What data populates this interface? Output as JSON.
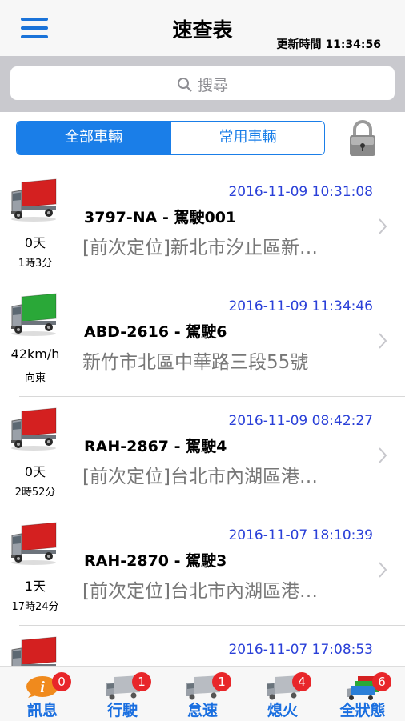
{
  "header": {
    "title": "速查表",
    "update_time": "更新時間 11:34:56"
  },
  "search": {
    "placeholder": "搜尋"
  },
  "segments": [
    "全部車輛",
    "常用車輛"
  ],
  "vehicles": [
    {
      "timestamp": "2016-11-09 10:31:08",
      "name": "3797-NA - 駕駛001",
      "address": "[前次定位]新北市汐止區新…",
      "speed": "0天",
      "sub": "1時3分",
      "truck_color": "#d42020"
    },
    {
      "timestamp": "2016-11-09 11:34:46",
      "name": "ABD-2616 - 駕駛6",
      "address": "新竹市北區中華路三段55號",
      "speed": "42km/h",
      "sub": "向東",
      "truck_color": "#2aa838"
    },
    {
      "timestamp": "2016-11-09 08:42:27",
      "name": "RAH-2867 - 駕駛4",
      "address": "[前次定位]台北市內湖區港…",
      "speed": "0天",
      "sub": "2時52分",
      "truck_color": "#d42020"
    },
    {
      "timestamp": "2016-11-07 18:10:39",
      "name": "RAH-2870 - 駕駛3",
      "address": "[前次定位]台北市內湖區港…",
      "speed": "1天",
      "sub": "17時24分",
      "truck_color": "#d42020"
    },
    {
      "timestamp": "2016-11-07 17:08:53",
      "name": "",
      "address": "",
      "speed": "",
      "sub": "",
      "truck_color": "#d42020"
    }
  ],
  "tabs": [
    {
      "label": "訊息",
      "badge": "0",
      "icon": "info-icon"
    },
    {
      "label": "行駛",
      "badge": "1",
      "icon": "truck-icon"
    },
    {
      "label": "怠速",
      "badge": "1",
      "icon": "truck-icon"
    },
    {
      "label": "熄火",
      "badge": "4",
      "icon": "truck-icon"
    },
    {
      "label": "全狀態",
      "badge": "6",
      "icon": "multi-truck-icon"
    }
  ]
}
